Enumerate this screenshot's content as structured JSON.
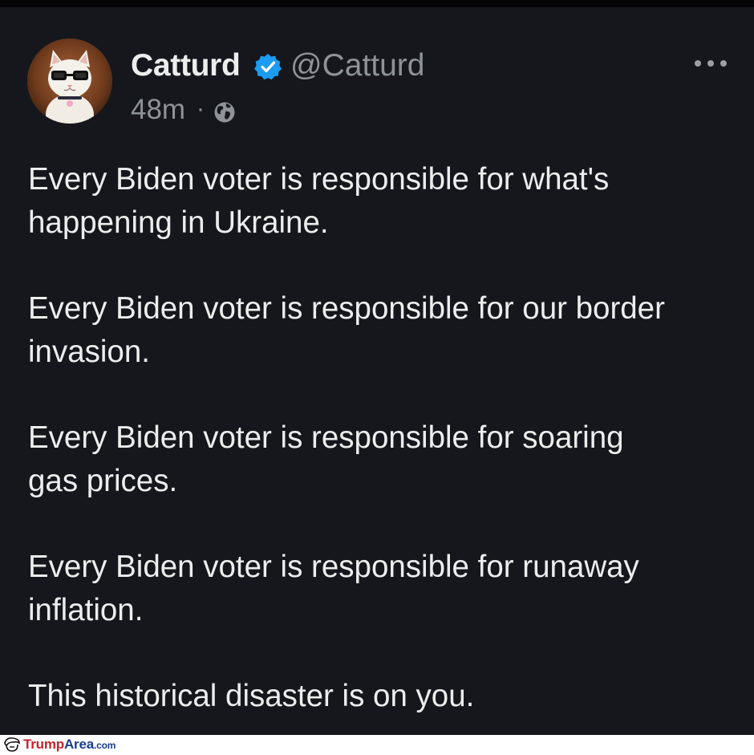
{
  "tweet": {
    "display_name": "Catturd",
    "handle": "@Catturd",
    "time": "48m",
    "separator": "·",
    "verified": true,
    "icons": {
      "verified": "verified-badge-icon",
      "visibility": "globe-icon",
      "menu": "more-options-icon"
    },
    "colors": {
      "background": "#15171c",
      "text": "#ededed",
      "muted": "#8e9398",
      "verified": "#1d9bf0"
    },
    "paragraphs": [
      {
        "lines": [
          "Every Biden voter is responsible for what's",
          "happening in Ukraine."
        ]
      },
      {
        "lines": [
          "Every Biden voter is responsible for our border",
          "invasion."
        ]
      },
      {
        "lines": [
          "Every Biden voter is responsible for soaring",
          "gas prices."
        ]
      },
      {
        "lines": [
          "Every Biden voter is responsible for runaway",
          "inflation."
        ]
      },
      {
        "lines": [
          "This historical disaster is on you."
        ]
      }
    ]
  },
  "watermark": {
    "brand_part1": "Trump",
    "brand_part2": "Area",
    "suffix": ".com",
    "colors": {
      "part1": "#c8242b",
      "part2": "#1a3d8f"
    }
  }
}
